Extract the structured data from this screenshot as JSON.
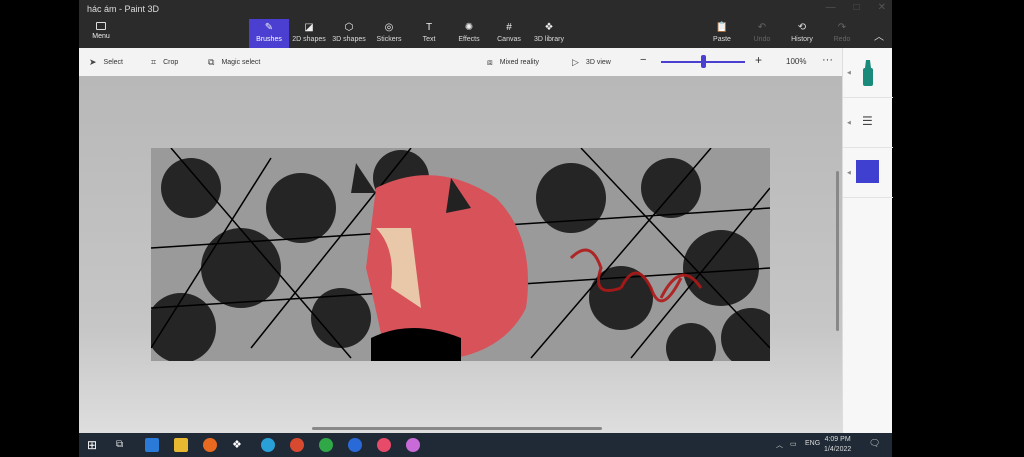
{
  "window": {
    "title": "hác ám - Paint 3D"
  },
  "menu": {
    "label": "Menu"
  },
  "tools": [
    {
      "label": "Brushes",
      "icon": "brush-icon"
    },
    {
      "label": "2D shapes",
      "icon": "2d-shapes-icon"
    },
    {
      "label": "3D shapes",
      "icon": "3d-shapes-icon"
    },
    {
      "label": "Stickers",
      "icon": "stickers-icon"
    },
    {
      "label": "Text",
      "icon": "text-icon"
    },
    {
      "label": "Effects",
      "icon": "effects-icon"
    },
    {
      "label": "Canvas",
      "icon": "canvas-icon"
    },
    {
      "label": "3D library",
      "icon": "3d-library-icon"
    }
  ],
  "right_tools": [
    {
      "label": "Paste"
    },
    {
      "label": "Undo"
    },
    {
      "label": "History"
    },
    {
      "label": "Redo"
    }
  ],
  "toolbar": {
    "select": "Select",
    "crop": "Crop",
    "magic_select": "Magic select",
    "mixed_reality": "Mixed reality",
    "view_3d": "3D view",
    "zoom_value": "100%",
    "zoom_fraction": 0.5
  },
  "side": {
    "swatch_color": "#4040d0"
  },
  "taskbar": {
    "lang": "ENG",
    "time": "4:09 PM",
    "date": "1/4/2022"
  },
  "colors": {
    "accent": "#4a3fd0"
  }
}
